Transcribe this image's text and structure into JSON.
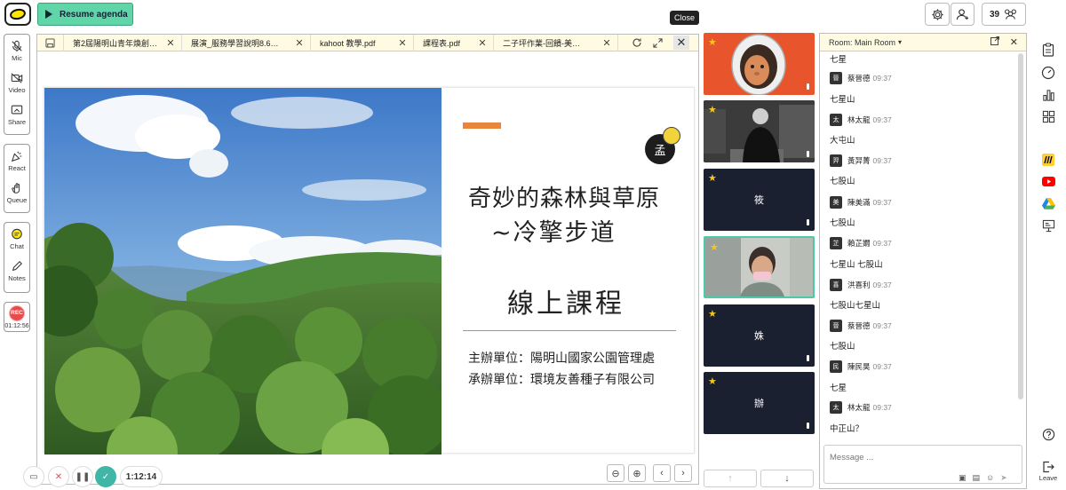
{
  "topbar": {
    "resume_label": "Resume agenda",
    "close_tooltip": "Close",
    "participants_count": "39"
  },
  "left_sidebar": {
    "mic": "Mic",
    "video": "Video",
    "share": "Share",
    "react": "React",
    "queue": "Queue",
    "chat": "Chat",
    "notes": "Notes",
    "rec": "REC",
    "rec_time": "01:12:56"
  },
  "viewer": {
    "tabs": [
      {
        "label": "第2屆陽明山青年煥創…"
      },
      {
        "label": "展演_服務學習說明8.6…"
      },
      {
        "label": "kahoot 教學.pdf"
      },
      {
        "label": "課程表.pdf"
      },
      {
        "label": "二子坪作業-回饋-美…"
      }
    ],
    "slide": {
      "badge": "孟",
      "title_line1": "奇妙的森林與草原",
      "title_line2": "~冷擎步道",
      "subtitle": "線上課程",
      "organizer": "主辦單位：陽明山國家公園管理處",
      "contractor": "承辦單位：環境友善種子有限公司"
    }
  },
  "controls": {
    "timer": "1:12:14"
  },
  "videos": [
    {
      "name": "",
      "type": "avatar-astronaut"
    },
    {
      "name": "",
      "type": "camera-man"
    },
    {
      "name": "筱",
      "type": "dark"
    },
    {
      "name": "",
      "type": "camera-woman"
    },
    {
      "name": "姝",
      "type": "dark"
    },
    {
      "name": "辦",
      "type": "dark"
    }
  ],
  "chat": {
    "room_label": "Room: Main Room",
    "input_placeholder": "Message ...",
    "messages": [
      {
        "avatar": "",
        "sender": "",
        "time": "",
        "text": "七星"
      },
      {
        "avatar": "晉",
        "sender": "蔡晉德",
        "time": "09:37",
        "text": "七星山"
      },
      {
        "avatar": "太",
        "sender": "林太龍",
        "time": "09:37",
        "text": "大屯山"
      },
      {
        "avatar": "羿",
        "sender": "黃羿菁",
        "time": "09:37",
        "text": "七股山"
      },
      {
        "avatar": "美",
        "sender": "陳美滿",
        "time": "09:37",
        "text": "七股山"
      },
      {
        "avatar": "芷",
        "sender": "賴芷嫺",
        "time": "09:37",
        "text": "七星山 七股山"
      },
      {
        "avatar": "喜",
        "sender": "洪喜利",
        "time": "09:37",
        "text": "七股山七星山"
      },
      {
        "avatar": "晉",
        "sender": "蔡晉德",
        "time": "09:37",
        "text": "七股山"
      },
      {
        "avatar": "民",
        "sender": "陳民昊",
        "time": "09:37",
        "text": "七星"
      },
      {
        "avatar": "太",
        "sender": "林太龍",
        "time": "09:37",
        "text": "中正山？"
      }
    ]
  },
  "right_sidebar": {
    "leave": "Leave"
  },
  "colors": {
    "accent_green": "#5fd5a8",
    "tab_bg": "#fffbe3",
    "rec_red": "#e74b4b",
    "slide_orange": "#e8873b",
    "video_dark": "#1b2030",
    "star_yellow": "#f7c51b"
  }
}
